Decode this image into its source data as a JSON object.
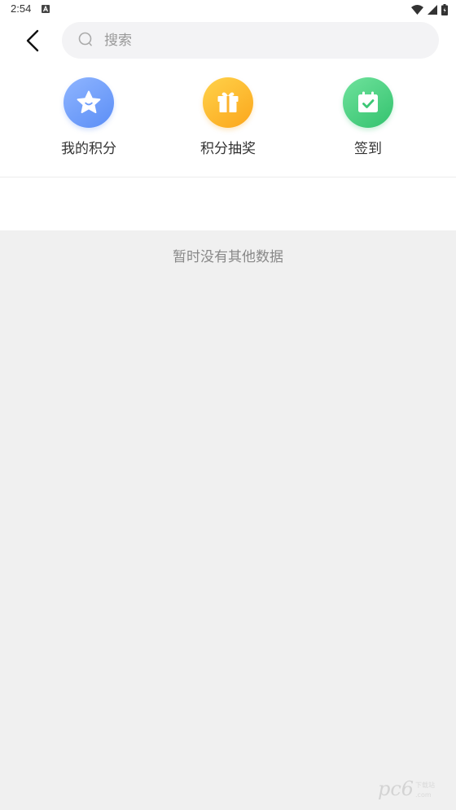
{
  "status_bar": {
    "time": "2:54",
    "notification_icon": "a-notification-icon",
    "icons": [
      "wifi-icon",
      "signal-icon",
      "battery-icon"
    ]
  },
  "header": {
    "back_icon": "chevron-left-icon",
    "search_placeholder": "搜索"
  },
  "entries": [
    {
      "label": "我的积分",
      "icon": "star-icon",
      "color": "#6c9cfb"
    },
    {
      "label": "积分抽奖",
      "icon": "gift-icon",
      "color": "#fdb62e"
    },
    {
      "label": "签到",
      "icon": "calendar-check-icon",
      "color": "#45cf7f"
    }
  ],
  "content": {
    "empty_text": "暂时没有其他数据"
  },
  "colors": {
    "top_background": "#ffffff",
    "page_background": "#f0f0f0",
    "search_background": "#f3f3f5"
  }
}
